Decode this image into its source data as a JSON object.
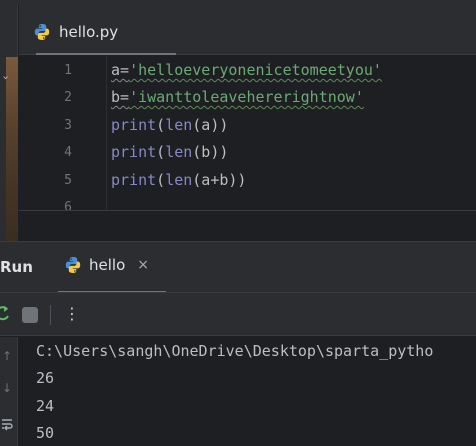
{
  "editor": {
    "tab": {
      "label": "hello.py",
      "icon": "python-file-icon"
    },
    "line_numbers": [
      "1",
      "2",
      "3",
      "4",
      "5",
      "6"
    ],
    "lines": [
      {
        "parts": [
          "a=",
          "'helloeveryonenicetomeetyou'"
        ]
      },
      {
        "parts": [
          "b=",
          "'iwanttoleavehererightnow'"
        ]
      },
      {
        "parts": [
          "print",
          "(",
          "len",
          "(a))"
        ]
      },
      {
        "parts": [
          "print",
          "(",
          "len",
          "(b))"
        ]
      },
      {
        "parts": [
          "print",
          "(",
          "len",
          "(a+b))"
        ]
      }
    ]
  },
  "run_panel": {
    "title": "Run",
    "tab_label": "hello",
    "tab_close": "×",
    "toolbar": {
      "rerun_icon": "rerun-icon",
      "stop_icon": "stop-icon",
      "more": "⋮"
    }
  },
  "console": {
    "lines": [
      "C:\\Users\\sangh\\OneDrive\\Desktop\\sparta_pytho",
      "26",
      "24",
      "50"
    ],
    "side_icons": [
      "up-arrow-icon",
      "down-arrow-icon",
      "soft-wrap-icon"
    ]
  },
  "colors": {
    "background": "#1e1f22",
    "panel": "#2b2d30",
    "keyword": "#8888c6",
    "string": "#6aab73",
    "text": "#bcbec4",
    "rerun_green": "#5fb865"
  }
}
